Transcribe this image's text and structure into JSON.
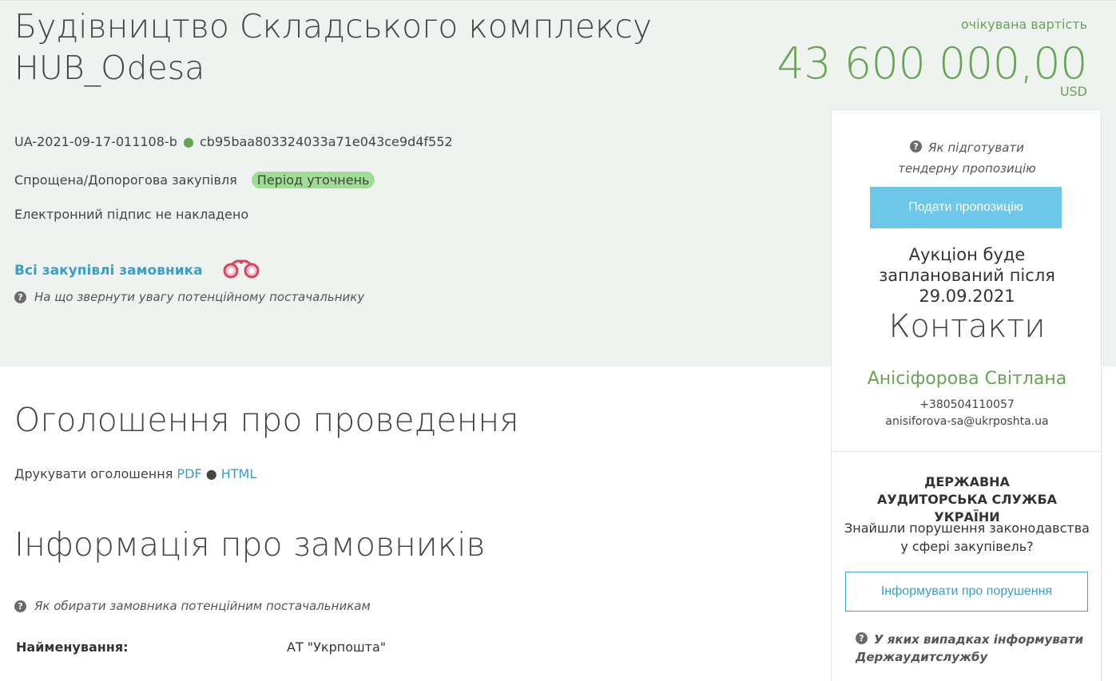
{
  "header": {
    "title": "Будівництво Складського комплексу HUB_Odesa",
    "value_label": "очікувана вартість",
    "value_amount": "43 600 000,00",
    "value_currency": "USD"
  },
  "tender": {
    "id": "UA-2021-09-17-011108-b",
    "separator": "●",
    "hash": "cb95baa803324033a71e043ce9d4f552",
    "procedure_type": "Спрощена/Допорогова закупівля",
    "status": "Період уточнень",
    "signature": "Електронний підпис не накладено",
    "all_procurements_link": "Всі закупівлі замовника",
    "supplier_hint": "На що звернути увагу потенційному постачальнику"
  },
  "announcement": {
    "title": "Оголошення про проведення",
    "print_label": "Друкувати оголошення",
    "pdf_link": "PDF",
    "separator": "●",
    "html_link": "HTML"
  },
  "customers": {
    "title": "Інформація про замовників",
    "hint": "Як обирати замовника потенційним постачальникам",
    "name_label": "Найменування:",
    "name_value": "АТ \"Укрпошта\""
  },
  "sidebar": {
    "bid_hint": "Як підготувати тендерну пропозицію",
    "submit_button": "Подати пропозицію",
    "auction_text": "Аукціон буде запланований після 29.09.2021",
    "contacts_title": "Контакти",
    "contact_name": "Анісіфорова Світлана",
    "contact_phone": "+380504110057",
    "contact_email": "anisiforova-sa@ukrposhta.ua",
    "audit_title": "ДЕРЖАВНА АУДИТОРСЬКА СЛУЖБА УКРАЇНИ",
    "audit_question": "Знайшли порушення законодавства у сфері закупівель?",
    "inform_button": "Інформувати про порушення",
    "audit_hint": "У яких випадках інформувати Держаудитслужбу"
  },
  "icons": {
    "help": "question-circle-icon",
    "binoculars": "binoculars-icon"
  },
  "colors": {
    "accent_green": "#67a553",
    "link_blue": "#3d9dc9",
    "button_blue": "#6cc7e8",
    "badge_green": "#9fdc95",
    "hero_bg": "#eef3ef"
  }
}
